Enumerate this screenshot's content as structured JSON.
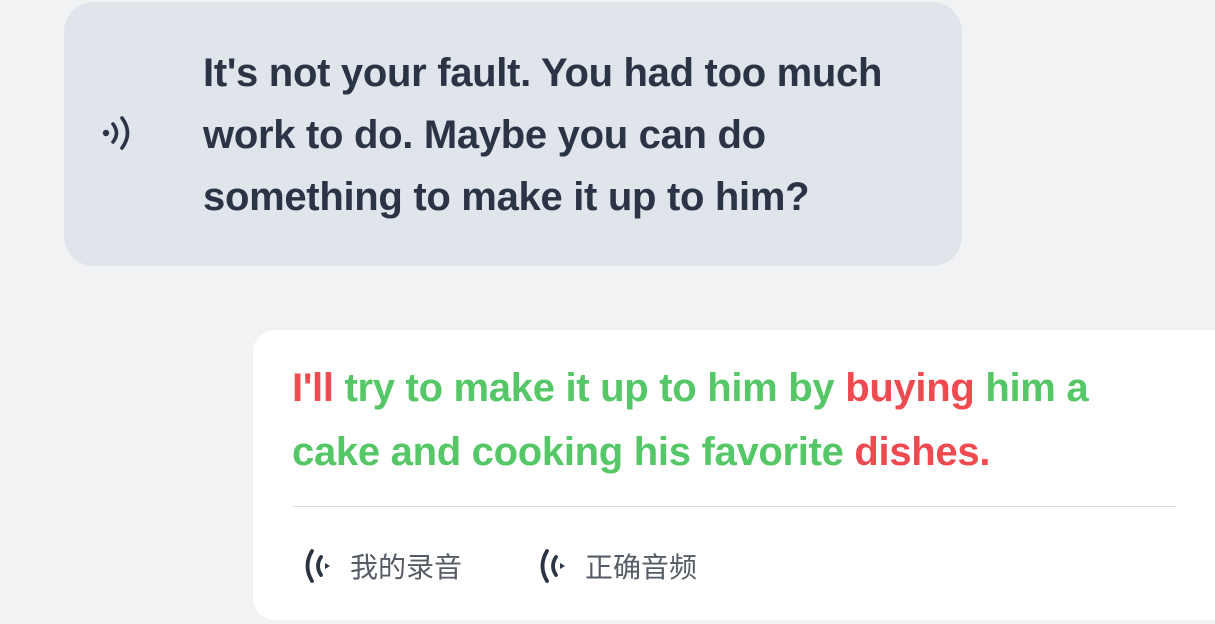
{
  "bot_message": {
    "icon": "speaker-icon",
    "text": "It's not your fault. You had too much work to do. Maybe you can do something to make it up to him?",
    "text_color": "#2b3445",
    "bubble_color": "#e0e4eb"
  },
  "user_answer": {
    "words": [
      {
        "text": "I'll",
        "status": "incorrect"
      },
      {
        "text": "try",
        "status": "correct"
      },
      {
        "text": "to",
        "status": "correct"
      },
      {
        "text": "make",
        "status": "correct"
      },
      {
        "text": "it",
        "status": "correct"
      },
      {
        "text": "up",
        "status": "correct"
      },
      {
        "text": "to",
        "status": "correct"
      },
      {
        "text": "him",
        "status": "correct"
      },
      {
        "text": "by",
        "status": "correct"
      },
      {
        "text": "buying",
        "status": "incorrect"
      },
      {
        "text": "him",
        "status": "correct"
      },
      {
        "text": "a",
        "status": "correct"
      },
      {
        "text": "cake",
        "status": "correct"
      },
      {
        "text": "and",
        "status": "correct"
      },
      {
        "text": "cooking",
        "status": "correct"
      },
      {
        "text": "his",
        "status": "correct"
      },
      {
        "text": "favorite",
        "status": "correct"
      },
      {
        "text": "dishes.",
        "status": "incorrect"
      }
    ],
    "colors": {
      "correct": "#55c766",
      "incorrect": "#ef4a4f"
    },
    "controls": {
      "my_recording_label": "我的录音",
      "correct_audio_label": "正确音频",
      "icon": "sound-wave-icon"
    }
  }
}
